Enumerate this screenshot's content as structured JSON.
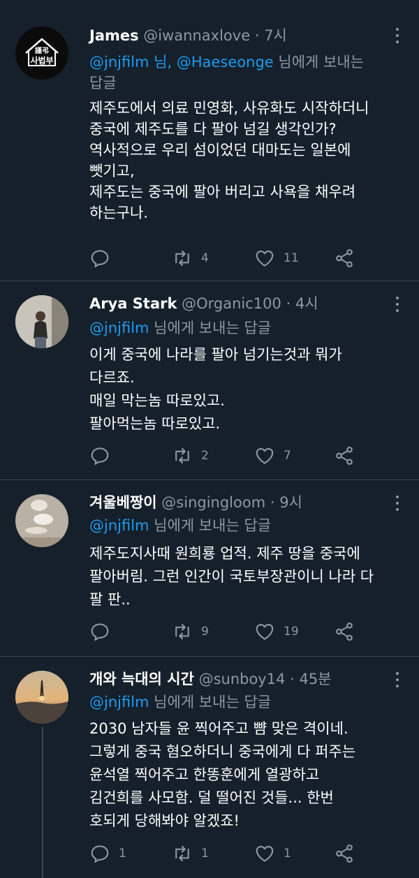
{
  "colors": {
    "background": "#15202b",
    "text": "#ffffff",
    "muted": "#8b98a5",
    "link": "#1d9bf0",
    "divider": "#38444d"
  },
  "tweets": [
    {
      "name": "James",
      "handle": "@iwannaxlove",
      "time": "7시",
      "avatar_text": {
        "line1": "謹弔",
        "line2": "사법부"
      },
      "reply_prefix": "@jnjfilm 님, @Haeseonge",
      "reply_suffix": " 님에게 보내는",
      "reply_line2": "답글",
      "body": [
        "제주도에서 의료 민영화, 사유화도 시작하더니",
        "중국에 제주도를 다 팔아 넘길 생각인가?",
        "역사적으로 우리 섬이었던 대마도는 일본에",
        "뺏기고,",
        "제주도는 중국에 팔아 버리고 사욕을 채우려",
        "하는구나."
      ],
      "replies": "",
      "retweets": "4",
      "likes": "11"
    },
    {
      "name": "Arya Stark",
      "handle": "@Organic100",
      "time": "4시",
      "reply_prefix": "@jnjfilm",
      "reply_suffix": " 님에게 보내는 답글",
      "body": [
        "이게 중국에 나라를 팔아 넘기는것과 뭐가",
        "다르죠.",
        "매일 막는놈 따로있고.",
        "팔아먹는놈 따로있고."
      ],
      "replies": "",
      "retweets": "2",
      "likes": "7"
    },
    {
      "name": "겨울베짱이",
      "handle": "@singingloom",
      "time": "9시",
      "reply_prefix": "@jnjfilm",
      "reply_suffix": " 님에게 보내는 답글",
      "body": [
        "제주도지사때 원희룡 업적. 제주 땅을 중국에",
        "팔아버림. 그런 인간이 국토부장관이니 나라 다",
        "팔 판.."
      ],
      "replies": "",
      "retweets": "9",
      "likes": "19"
    },
    {
      "name": "개와 늑대의 시간",
      "handle": "@sunboy14",
      "time": "45분",
      "reply_prefix": "@jnjfilm",
      "reply_suffix": " 님에게 보내는 답글",
      "body": [
        "2030 남자들 윤 찍어주고 뺨 맞은 격이네.",
        "그렇게 중국 혐오하더니 중국에게 다 퍼주는",
        "윤석열 찍어주고 한똥훈에게 열광하고",
        "김건희를 사모함. 덜 떨어진 것들... 한번",
        "호되게 당해봐야 알겠죠!"
      ],
      "replies": "1",
      "retweets": "1",
      "likes": "1"
    }
  ]
}
